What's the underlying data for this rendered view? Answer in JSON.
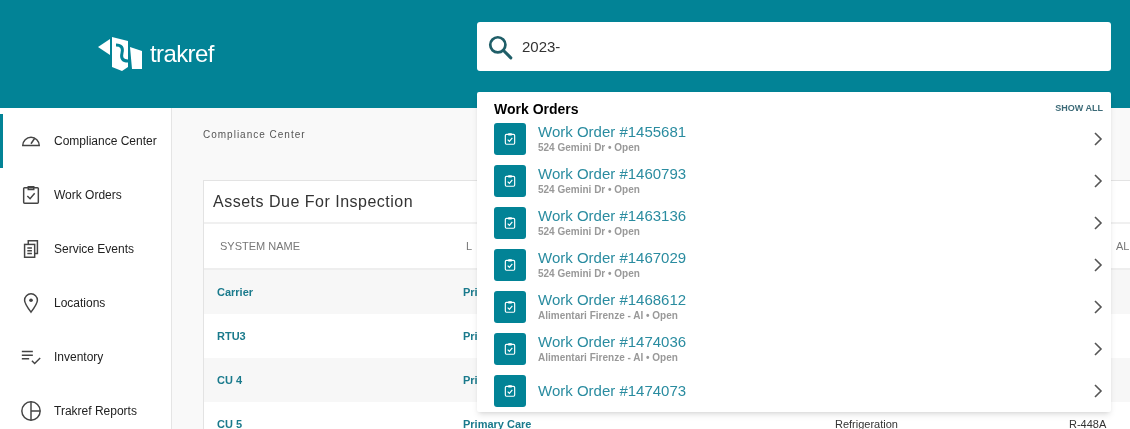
{
  "header": {
    "logo_text": "trakref",
    "search": {
      "value": "2023-"
    }
  },
  "sidebar": {
    "items": [
      {
        "label": "Compliance Center",
        "selected": true
      },
      {
        "label": "Work Orders",
        "selected": false
      },
      {
        "label": "Service Events",
        "selected": false
      },
      {
        "label": "Locations",
        "selected": false
      },
      {
        "label": "Inventory",
        "selected": false
      },
      {
        "label": "Trakref Reports",
        "selected": false
      }
    ]
  },
  "breadcrumb": "Compliance Center",
  "card": {
    "title": "Assets Due For Inspection",
    "columns": [
      "SYSTEM NAME",
      "L",
      "",
      "",
      "AL"
    ],
    "rows": [
      [
        "Carrier",
        "Pri",
        "",
        "",
        ""
      ],
      [
        "RTU3",
        "Pri",
        "",
        "",
        ""
      ],
      [
        "CU 4",
        "Pri",
        "",
        "",
        ""
      ],
      [
        "CU 5",
        "Primary Care",
        "Refrigeration",
        "R-448A",
        ""
      ]
    ]
  },
  "search_results": {
    "section": "Work Orders",
    "show_all": "SHOW ALL",
    "items": [
      {
        "title": "Work Order #1455681",
        "subtitle": "524 Gemini Dr • Open"
      },
      {
        "title": "Work Order #1460793",
        "subtitle": "524 Gemini Dr • Open"
      },
      {
        "title": "Work Order #1463136",
        "subtitle": "524 Gemini Dr • Open"
      },
      {
        "title": "Work Order #1467029",
        "subtitle": "524 Gemini Dr • Open"
      },
      {
        "title": "Work Order #1468612",
        "subtitle": "Alimentari Firenze - AI • Open"
      },
      {
        "title": "Work Order #1474036",
        "subtitle": "Alimentari Firenze - AI • Open"
      },
      {
        "title": "Work Order #1474073"
      }
    ]
  }
}
